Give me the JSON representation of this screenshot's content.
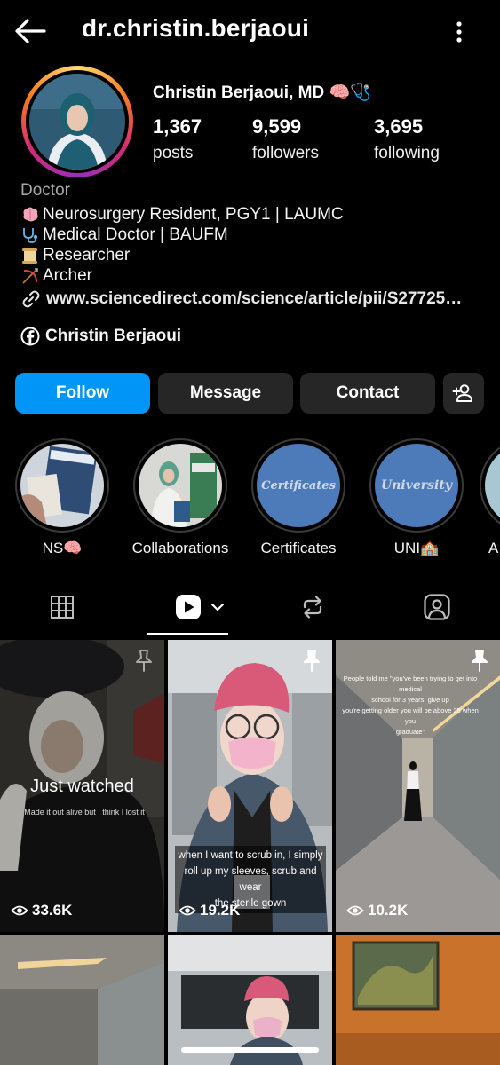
{
  "header": {
    "username": "dr.christin.berjaoui"
  },
  "profile": {
    "full_name": "Christin Berjaoui, MD 🧠🩺",
    "stats": [
      {
        "value": "1,367",
        "label": "posts"
      },
      {
        "value": "9,599",
        "label": "followers"
      },
      {
        "value": "3,695",
        "label": "following"
      }
    ],
    "category": "Doctor",
    "bio": [
      "Neurosurgery Resident, PGY1 | LAUMC",
      "Medical Doctor | BAUFM",
      "Researcher",
      "Archer"
    ],
    "link": "www.sciencedirect.com/science/article/pii/S27725…",
    "facebook": "Christin Berjaoui"
  },
  "buttons": {
    "follow": "Follow",
    "message": "Message",
    "contact": "Contact"
  },
  "highlights": [
    {
      "caption": "NS🧠"
    },
    {
      "caption": "Collaborations"
    },
    {
      "caption": "Certificates",
      "cover_text": "Certificates"
    },
    {
      "caption": "UNI🏫",
      "cover_text": "University"
    },
    {
      "caption": "A"
    }
  ],
  "tabs": [
    "grid-icon",
    "reels-icon",
    "reposts-icon",
    "tagged-icon"
  ],
  "reels": [
    {
      "views": "33.6K",
      "label": "Just watched",
      "caption": "Made it out alive but I think I lost it"
    },
    {
      "views": "19.2K",
      "caption_lines": [
        "when I want to scrub in, I simply",
        "roll up my sleeves, scrub and wear",
        "the sterile gown"
      ]
    },
    {
      "views": "10.2K",
      "caption_lines": [
        "People told me \"you've been trying to get into medical",
        "school for 3 years, give up",
        "you're getting older you will be above 25 when you",
        "graduate\""
      ]
    }
  ],
  "colors": {
    "accent": "#0095f6",
    "button_bg": "#262626",
    "background": "#000000"
  }
}
